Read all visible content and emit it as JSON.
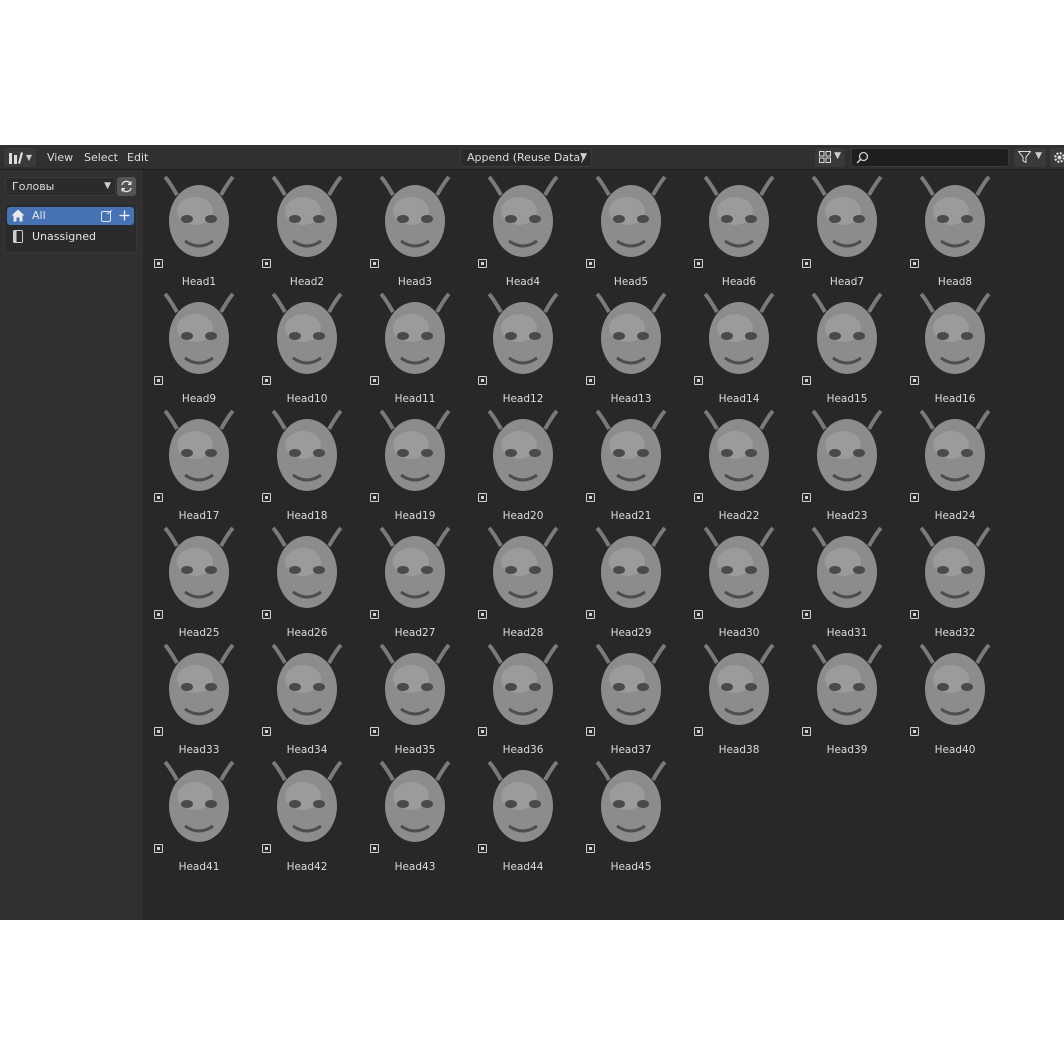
{
  "header": {
    "menus": [
      "View",
      "Select",
      "Edit"
    ],
    "import_method": "Append (Reuse Data)",
    "search": {
      "value": "",
      "placeholder": ""
    }
  },
  "sidebar": {
    "library": "Головы",
    "catalogs": [
      {
        "label": "All",
        "active": true
      },
      {
        "label": "Unassigned",
        "active": false
      }
    ]
  },
  "colors": {
    "accent": "#4772b3",
    "background": "#282828",
    "header": "#303030",
    "thumbnail": "#9a9a9a"
  },
  "assets": [
    "Head1",
    "Head2",
    "Head3",
    "Head4",
    "Head5",
    "Head6",
    "Head7",
    "Head8",
    "Head9",
    "Head10",
    "Head11",
    "Head12",
    "Head13",
    "Head14",
    "Head15",
    "Head16",
    "Head17",
    "Head18",
    "Head19",
    "Head20",
    "Head21",
    "Head22",
    "Head23",
    "Head24",
    "Head25",
    "Head26",
    "Head27",
    "Head28",
    "Head29",
    "Head30",
    "Head31",
    "Head32",
    "Head33",
    "Head34",
    "Head35",
    "Head36",
    "Head37",
    "Head38",
    "Head39",
    "Head40",
    "Head41",
    "Head42",
    "Head43",
    "Head44",
    "Head45"
  ]
}
